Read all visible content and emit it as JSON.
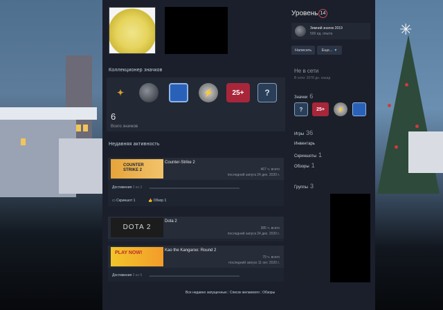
{
  "badges_section": {
    "title": "Коллекционер значков",
    "count": "6",
    "caption": "Всего значков",
    "items": [
      {
        "icon": "candy-cane-badge-icon"
      },
      {
        "icon": "ornament-badge-icon"
      },
      {
        "icon": "blue-tile-badge-icon"
      },
      {
        "icon": "lightning-badge-icon"
      },
      {
        "icon": "years-25-badge-icon",
        "text": "25+"
      },
      {
        "icon": "question-box-badge-icon",
        "text": "?"
      }
    ]
  },
  "activity": {
    "title": "Недавняя активность",
    "games": [
      {
        "name": "Counter-Strike 2",
        "hours": "467 ч. всего",
        "last": "последний запуск 24 дек. 2020 г.",
        "achievements_label": "Достижения",
        "achievements_value": "0 из 3",
        "screenshots_label": "Скриншот 1",
        "review_label": "Обзор 1"
      },
      {
        "name": "Dota 2",
        "art_text": "DOTA 2",
        "hours": "385 ч. всего",
        "last": "последний запуск 24 дек. 2020 г."
      },
      {
        "name": "Kao the Kangaroo: Round 2",
        "art_text": "PLAY NOW!",
        "hours": "79 ч. всего",
        "last": "последний запуск 11 окт. 2020 г.",
        "achievements_label": "Достижения",
        "achievements_value": "0 из 9"
      }
    ],
    "footer": {
      "recent": "Все недавно запущенные",
      "sep": "|",
      "wishlist": "Список желаемого",
      "reviews": "Обзоры"
    }
  },
  "cs2_art": {
    "line1": "COUNTER",
    "line2": "STRIKE 2"
  },
  "side": {
    "level_label": "Уровень",
    "level_value": "14",
    "fav_badge_name": "Зимний значок 2019",
    "fav_badge_xp": "500 ед. опыта",
    "write_button": "Написать",
    "more_button": "Еще...",
    "status": "Не в сети",
    "status_sub": "В сети: 2078 дн. назад",
    "badges_label": "Значки",
    "badges_count": "6",
    "games_label": "Игры",
    "games_count": "36",
    "inventory_label": "Инвентарь",
    "screenshots_label": "Скриншоты",
    "screenshots_count": "1",
    "reviews_label": "Обзоры",
    "reviews_count": "1",
    "groups_label": "Группы",
    "groups_count": "3"
  },
  "colors": {
    "level_ring": "#c84c5a",
    "panel_bg": "#1a1f2b",
    "badge_blue": "#2a61b8",
    "badge_red": "#a8263a"
  }
}
